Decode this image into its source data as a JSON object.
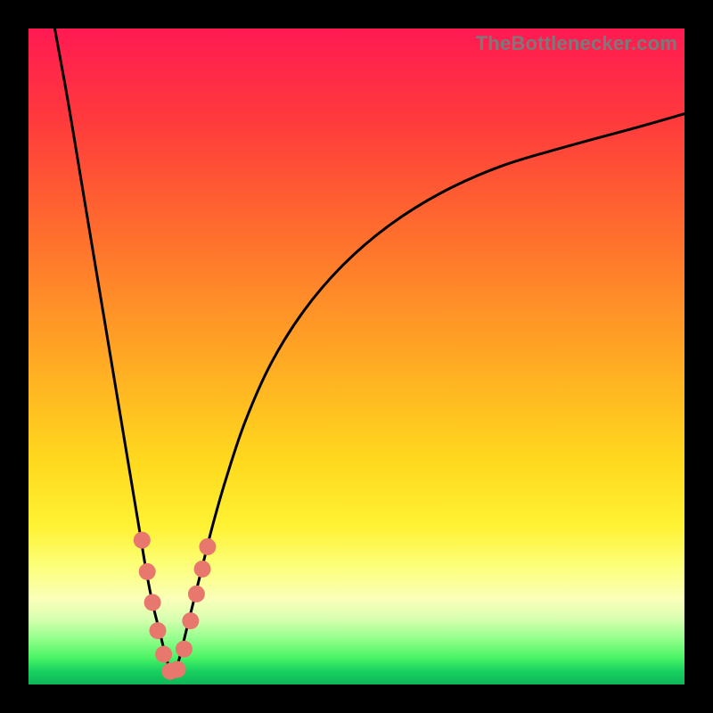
{
  "watermark": "TheBottlenecker.com",
  "chart_data": {
    "type": "line",
    "title": "",
    "xlabel": "",
    "ylabel": "",
    "xlim": [
      0,
      100
    ],
    "ylim": [
      0,
      100
    ],
    "notch_x": 22,
    "series": [
      {
        "name": "left-branch",
        "x": [
          4,
          6,
          8,
          10,
          12,
          14,
          16,
          17,
          18,
          19,
          20,
          21,
          22
        ],
        "y": [
          100,
          89,
          77,
          65,
          53,
          41,
          29,
          23,
          17,
          12,
          8,
          4,
          1
        ]
      },
      {
        "name": "right-branch",
        "x": [
          22,
          23,
          24,
          25,
          26,
          27,
          28,
          30,
          33,
          37,
          42,
          48,
          55,
          63,
          72,
          82,
          93,
          100
        ],
        "y": [
          1,
          4,
          8,
          12,
          16,
          20,
          24,
          31,
          40,
          49,
          57,
          64,
          70,
          75,
          79,
          82,
          85,
          87
        ]
      }
    ],
    "markers": {
      "name": "highlight-dots",
      "color": "#e8776d",
      "points": [
        {
          "x": 17.3,
          "y": 22.0
        },
        {
          "x": 18.1,
          "y": 17.2
        },
        {
          "x": 18.9,
          "y": 12.5
        },
        {
          "x": 19.7,
          "y": 8.2
        },
        {
          "x": 20.6,
          "y": 4.6
        },
        {
          "x": 21.6,
          "y": 2.0
        },
        {
          "x": 22.7,
          "y": 2.3
        },
        {
          "x": 23.7,
          "y": 5.4
        },
        {
          "x": 24.7,
          "y": 9.7
        },
        {
          "x": 25.6,
          "y": 13.8
        },
        {
          "x": 26.5,
          "y": 17.6
        },
        {
          "x": 27.3,
          "y": 21.0
        }
      ]
    }
  }
}
